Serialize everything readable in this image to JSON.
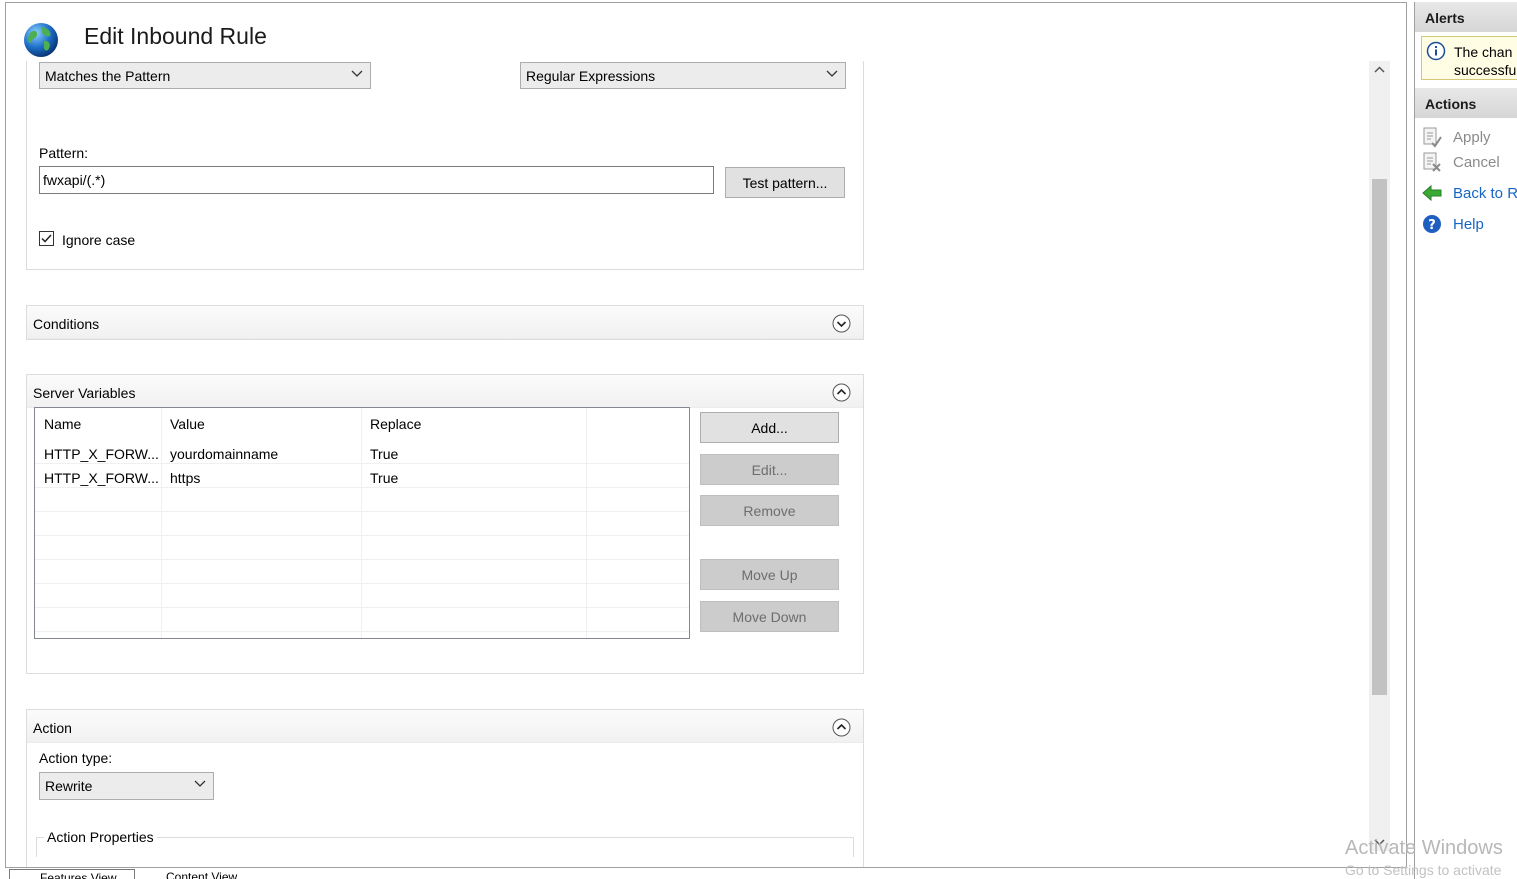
{
  "page": {
    "title": "Edit Inbound Rule"
  },
  "match": {
    "requested_url": "Matches the Pattern",
    "using": "Regular Expressions",
    "pattern_label": "Pattern:",
    "pattern_value": "fwxapi/(.*)",
    "test_pattern_label": "Test pattern...",
    "ignore_case_label": "Ignore case",
    "ignore_case_checked": true
  },
  "conditions": {
    "title": "Conditions"
  },
  "server_variables": {
    "title": "Server Variables",
    "columns": [
      "Name",
      "Value",
      "Replace"
    ],
    "rows": [
      {
        "name": "HTTP_X_FORW...",
        "value": "yourdomainname",
        "replace": "True"
      },
      {
        "name": "HTTP_X_FORW...",
        "value": "https",
        "replace": "True"
      }
    ],
    "buttons": {
      "add": "Add...",
      "edit": "Edit...",
      "remove": "Remove",
      "move_up": "Move Up",
      "move_down": "Move Down"
    }
  },
  "action": {
    "title": "Action",
    "action_type_label": "Action type:",
    "action_type_value": "Rewrite",
    "properties_label": "Action Properties"
  },
  "right_pane": {
    "alerts_title": "Alerts",
    "alert_line1": "The chan",
    "alert_line2": "successfu",
    "actions_title": "Actions",
    "apply": "Apply",
    "cancel": "Cancel",
    "back_to_rules": "Back to Ru",
    "help": "Help"
  },
  "watermark": {
    "line1": "Activate Windows",
    "line2": "Go to Settings to activate"
  },
  "bottom_tabs": {
    "features_view": "Features View",
    "content_view": "Content View"
  },
  "colors": {
    "accent": "#1666c5",
    "alert_bg": "#fffde3"
  }
}
